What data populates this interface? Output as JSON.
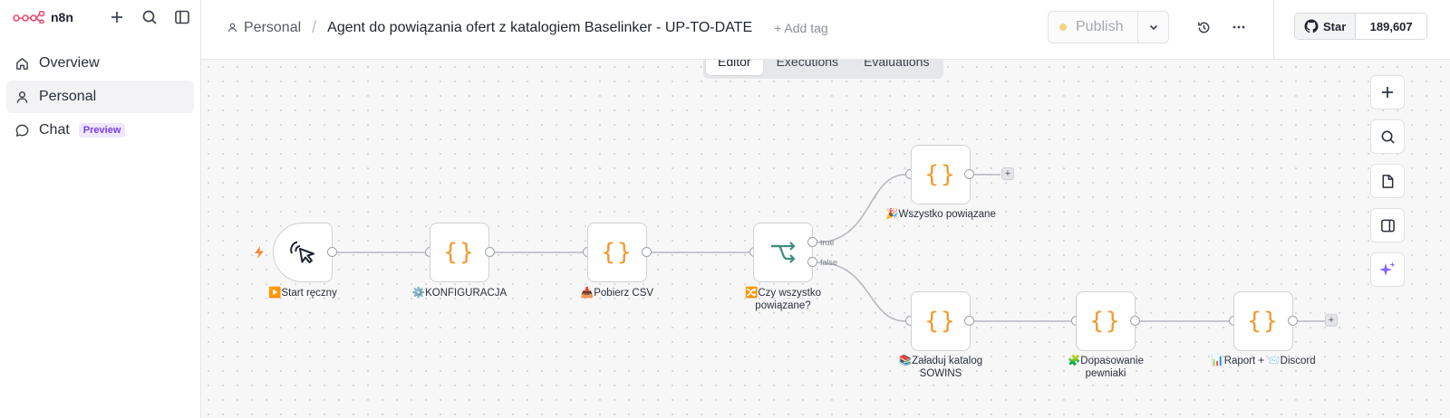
{
  "sidebar": {
    "logo_text": "n8n",
    "items": [
      {
        "label": "Overview",
        "icon": "home-icon"
      },
      {
        "label": "Personal",
        "icon": "user-icon"
      },
      {
        "label": "Chat",
        "icon": "chat-icon",
        "badge": "Preview"
      }
    ]
  },
  "header": {
    "project": "Personal",
    "workflow_title": "Agent do powiązania ofert z katalogiem Baselinker - UP-TO-DATE",
    "add_tag": "+ Add tag",
    "publish_label": "Publish",
    "star_label": "Star",
    "star_count": "189,607"
  },
  "tabs": [
    {
      "label": "Editor",
      "active": true
    },
    {
      "label": "Executions",
      "active": false
    },
    {
      "label": "Evaluations",
      "active": false
    }
  ],
  "nodes": [
    {
      "label": "▶️Start ręczny",
      "icon": "cursor-click-icon"
    },
    {
      "label": "⚙️KONFIGURACJA",
      "icon": "code-braces-icon"
    },
    {
      "label": "📥Pobierz CSV",
      "icon": "code-braces-icon"
    },
    {
      "label": "🔀Czy wszystko powiązane?",
      "icon": "if-branch-icon"
    },
    {
      "label": "🎉Wszystko powiązane",
      "icon": "code-braces-icon"
    },
    {
      "label": "📚Załaduj katalog SOWINS",
      "icon": "code-braces-icon"
    },
    {
      "label": "🧩Dopasowanie pewniaki",
      "icon": "code-braces-icon"
    },
    {
      "label": "📊Raport + 📨Discord",
      "icon": "code-braces-icon"
    }
  ],
  "branch_labels": {
    "true": "true",
    "false": "false"
  },
  "colors": {
    "accent_orange": "#f29a2e",
    "brand": "#ea4b71",
    "preview_badge": "#7a3ee8"
  }
}
